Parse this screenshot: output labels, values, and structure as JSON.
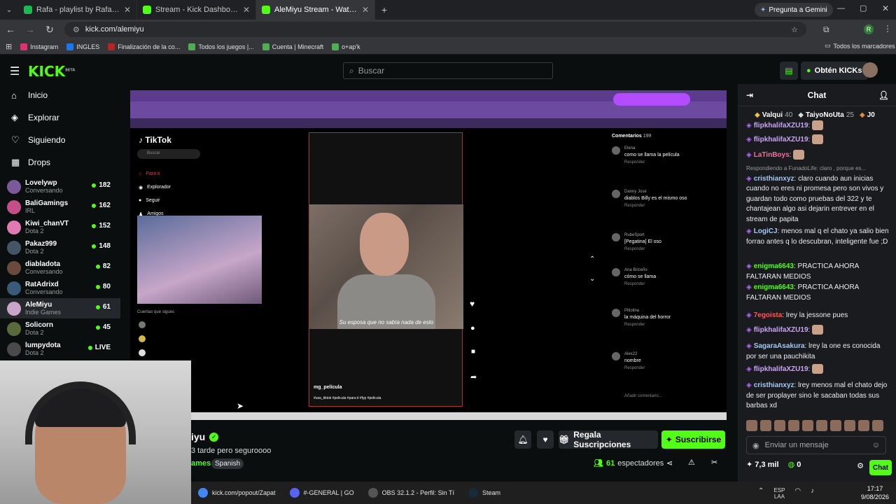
{
  "browser": {
    "tabs": [
      {
        "label": "Rafa - playlist by Rafael.xared |",
        "color": "#1db954",
        "active": false
      },
      {
        "label": "Stream - Kick Dashboard",
        "color": "#53fc18",
        "active": false
      },
      {
        "label": "AleMiyu Stream - Watch Li",
        "color": "#53fc18",
        "active": true
      }
    ],
    "gemini_button": "Pregunta a Gemini",
    "url": "kick.com/alemiyu",
    "bookmarks": [
      "Instagram",
      "INGLES",
      "Finalización de la co...",
      "Todos los juegos |...",
      "Cuenta | Minecraft",
      "o+ap'k"
    ],
    "all_bookmarks": "Todos los marcadores"
  },
  "header": {
    "logo": "KICK",
    "logo_badge": "BETA",
    "search_placeholder": "Buscar",
    "get_kicks": "Obtén KICKs"
  },
  "nav": [
    {
      "label": "Inicio",
      "icon": "home-icon"
    },
    {
      "label": "Explorar",
      "icon": "compass-icon"
    },
    {
      "label": "Siguiendo",
      "icon": "heart-icon"
    },
    {
      "label": "Drops",
      "icon": "drops-icon"
    }
  ],
  "channels": [
    {
      "name": "Lovelywp",
      "category": "Conversando",
      "viewers": "182",
      "color": "#7b5a9a"
    },
    {
      "name": "BaliGamings",
      "category": "IRL",
      "viewers": "162",
      "color": "#c44e8a"
    },
    {
      "name": "Kiwi_chanVT",
      "category": "Dota 2",
      "viewers": "152",
      "color": "#e07ab3"
    },
    {
      "name": "Pakaz999",
      "category": "Dota 2",
      "viewers": "148",
      "color": "#445566"
    },
    {
      "name": "diabladota",
      "category": "Conversando",
      "viewers": "82",
      "color": "#6a4a3a"
    },
    {
      "name": "RatAdrixd",
      "category": "Conversando",
      "viewers": "80",
      "color": "#3a5a7a"
    },
    {
      "name": "AleMiyu",
      "category": "Indie Games",
      "viewers": "61",
      "color": "#c9a6c9"
    },
    {
      "name": "Solicorn",
      "category": "Dota 2",
      "viewers": "45",
      "color": "#5a6a3a"
    },
    {
      "name": "lumpydota",
      "category": "Dota 2",
      "viewers": "LIVE",
      "color": "#4a4a4a"
    }
  ],
  "video": {
    "tiktok_label": "TikTok",
    "tiktok_search": "Buscar",
    "tiktok_nav": [
      "Para ti",
      "Explorador",
      "Seguir",
      "Amigos"
    ],
    "subtitle": "Su esposa que no sabía nada de esto",
    "author": "mg_película",
    "hashtags": "#usa_tiktok #pelicula #para ti #fyp #pelicula",
    "following_header": "Cuentas que sigues",
    "comments_title": "Comentarios",
    "comments_count": "199",
    "comments": [
      {
        "name": "Elena",
        "text": "como se llama la película"
      },
      {
        "name": "Danny José",
        "text": "diablos Billy es el mismo oso"
      },
      {
        "name": "RubeSport",
        "text": "[Pegatina] El oso"
      },
      {
        "name": "Ana Briceño",
        "text": "cómo se llama"
      },
      {
        "name": "Pitiolina",
        "text": "la máquina del horror"
      },
      {
        "name": "Alex22",
        "text": "nombre"
      }
    ],
    "reply_label": "Responder",
    "add_comment": "Añadir comentario..."
  },
  "stream": {
    "name": "AleMiyu",
    "name_visible": "iyu",
    "title_visible": "3 tarde pero seguroooo",
    "category_visible": "ames",
    "language": "Spanish",
    "gift_button": "Regala Suscripciones",
    "subscribe_button": "Suscribirse",
    "viewers": "61",
    "viewers_label": "espectadores"
  },
  "chat": {
    "title": "Chat",
    "leaders": [
      {
        "name": "Valqui",
        "count": "40"
      },
      {
        "name": "TaiyoNoUta",
        "count": "25"
      },
      {
        "name": "J0",
        "count": ""
      }
    ],
    "messages": [
      {
        "user": "flipkhalifaXZU19",
        "color": "#c9a6f5",
        "text": "",
        "emote": true
      },
      {
        "user": "flipkhalifaXZU19",
        "color": "#c9a6f5",
        "text": "",
        "emote": true
      },
      {
        "user": "LaTinBoys",
        "color": "#ff6b9a",
        "text": "",
        "emote": true
      },
      {
        "user": "cristhianxyz",
        "color": "#a6c9f5",
        "text": "claro cuando aun inicias cuando no eres ni promesa pero son vivos y guardan todo como pruebas del 322 y te chantajean algo asi dejarin entrever en el stream de papita",
        "reply": "Respondiendo a FunadoLife: claro , porque es..."
      },
      {
        "user": "LogiCJ",
        "color": "#a6c9f5",
        "text": "menos mal q el chato ya salio bien forrao antes q lo descubran, inteligente fue ;D"
      },
      {
        "user": "enigma6643",
        "color": "#53fc18",
        "text": "PRACTICA AHORA FALTARAN MEDIOS"
      },
      {
        "user": "enigma6643",
        "color": "#53fc18",
        "text": "PRACTICA AHORA FALTARAN MEDIOS"
      },
      {
        "user": "7egoista",
        "color": "#ff5a5a",
        "text": "lrey la jessone pues"
      },
      {
        "user": "flipkhalifaXZU19",
        "color": "#c9a6f5",
        "text": "",
        "emote": true
      },
      {
        "user": "SagaraAsakura",
        "color": "#a6c9f5",
        "text": "lrey la one es conocida por ser una pauchikita"
      },
      {
        "user": "flipkhalifaXZU19",
        "color": "#c9a6f5",
        "text": "",
        "emote": true
      },
      {
        "user": "cristhianxyz",
        "color": "#a6c9f5",
        "text": "lrey menos mal el chato dejo de ser proplayer sino le sacaban todas sus barbas xd"
      }
    ],
    "input_placeholder": "Enviar un mensaje",
    "kicks": "7,3 mil",
    "points": "0",
    "send_button": "Chat"
  },
  "taskbar": {
    "items": [
      {
        "label": "kick.com/popout/Zapat",
        "color": "#4285f4"
      },
      {
        "label": "#-GENERAL | GO",
        "color": "#5865f2"
      },
      {
        "label": "OBS 32.1.2 - Perfil: Sin Tí",
        "color": "#555555"
      },
      {
        "label": "Steam",
        "color": "#1b2838"
      }
    ],
    "lang": "ESP",
    "lang2": "LAA",
    "time": "17:17",
    "date": "9/08/2026"
  }
}
